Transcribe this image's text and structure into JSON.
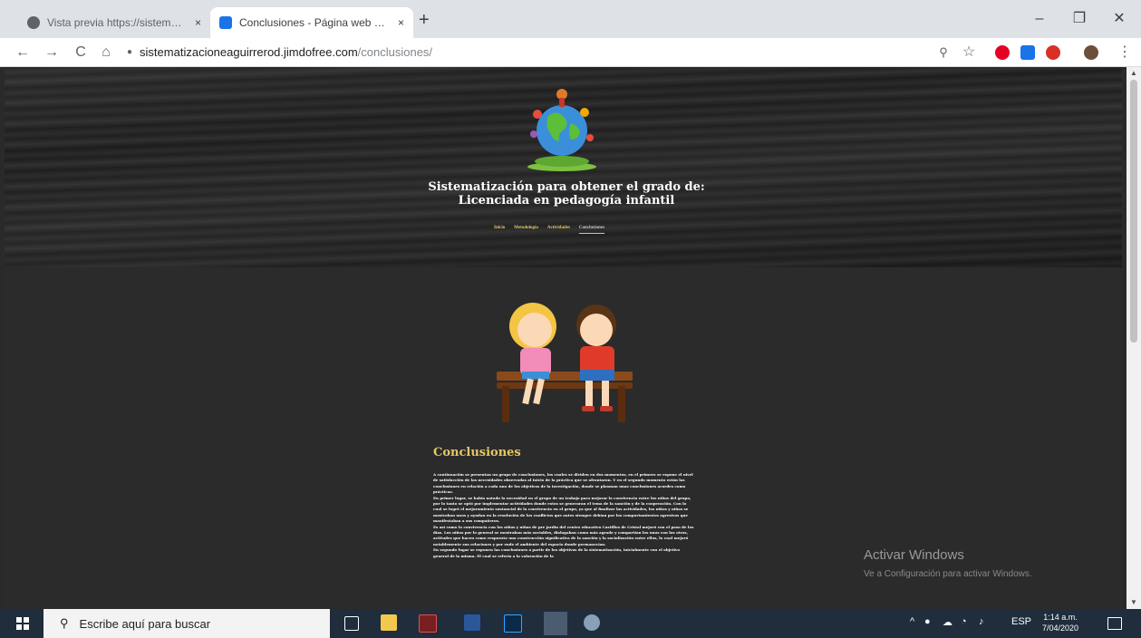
{
  "browser": {
    "tabs": [
      {
        "title": "Vista previa https://sistematizac",
        "active": false
      },
      {
        "title": "Conclusiones - Página web de si",
        "active": true
      }
    ],
    "new_tab_symbol": "+",
    "close_symbol": "×",
    "window_controls": {
      "minimize": "–",
      "maximize": "❐",
      "close": "✕"
    },
    "nav": {
      "back": "←",
      "forward": "→",
      "reload": "C",
      "home": "⌂"
    },
    "url_domain": "sistematizacioneaguirrerod.jimdofree.com",
    "url_path": "/conclusiones/",
    "zoom_icon": "⚲",
    "star_icon": "☆",
    "menu_icon": "⋮"
  },
  "site": {
    "title_line1": "Sistematización para obtener el grado de:",
    "title_line2": "Licenciada en pedagogía infantil",
    "nav": [
      "Inicio",
      "Metodología",
      "Actividades",
      "Conclusiones"
    ],
    "active_nav": "Conclusiones"
  },
  "content": {
    "section_title": "Conclusiones",
    "paragraphs": [
      "A continuación se presentan un grupo de conclusiones, los cuales se dividen en dos momentos, en el primero se expone el nivel de satisfacción de las necesidades observadas al inicio de la práctica que se afrontaron. Y en el segundo momento están las conclusiones en relación a cada uno de los objetivos de la investigación, donde se plasman unas conclusiones acordes como prácticas.",
      "En primer lugar, se había notado la necesidad en el grupo de un trabajo para mejorar la convivencia entre los niños del grupo, por lo tanto se optó por implementar actividades donde estos se generaran el tema de la sanción y de la cooperación. Con lo cual se logró el mejoramiento sustancial de la convivencia en el grupo, ya que al finalizar las actividades, los niños y niñas se mostraban unos y ayudan en la resolución de los conflictos que antes siempre debían por los comportamientos agresivos que manifestaban a sus compañeros.",
      "Es así como la convivencia con los niños y niñas de pre jardín del centro educativo Castillos de Cristal mejoró con el paso de los días. Los niños por lo general se mostraban más sociables, dialogaban como más agrado y compartían los unos con los otros, actitudes que hacen como respuesta una construcción significativa de la sanción y la socialización entre ellos, lo cual mejoró notablemente sus relaciones y por ende el ambiente del espacio donde permanecían.",
      "En segundo lugar se exponen las conclusiones a partir de los objetivos de la sistematización, inicialmente con el objetivo general de la misma. El cual se refería a la valoración de la"
    ]
  },
  "watermark": {
    "title": "Activar Windows",
    "subtitle": "Ve a Configuración para activar Windows."
  },
  "taskbar": {
    "search_placeholder": "Escribe aquí para buscar",
    "search_icon": "⚲",
    "language": "ESP",
    "time": "1:14 a.m.",
    "date": "7/04/2020",
    "tray_arrow": "^"
  },
  "colors": {
    "accent": "#e6c766",
    "header_bg": "#252525",
    "content_bg": "#2b2b2b",
    "taskbar_bg": "#1f2d3d"
  }
}
